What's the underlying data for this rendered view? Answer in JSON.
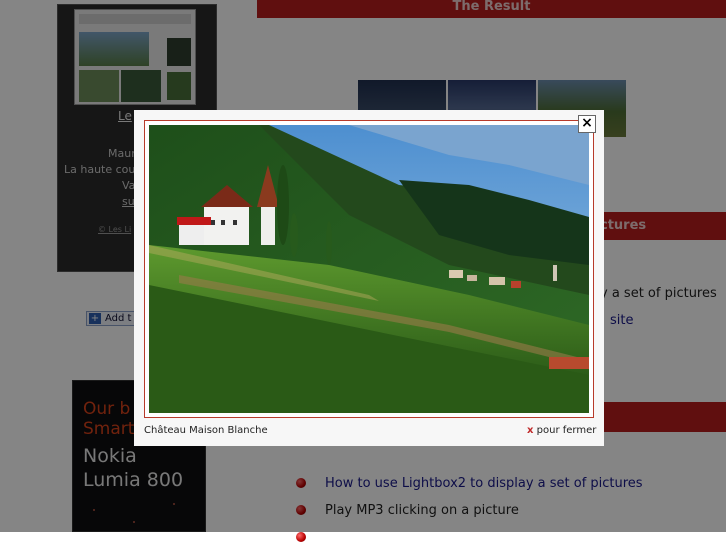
{
  "sidebar": {
    "site_link": "Le",
    "line1": "Maur",
    "line2": "La haute cout",
    "line3": "Va",
    "line4": "su",
    "footer_link": "© Les Li",
    "add_button": "Add t"
  },
  "ad": {
    "line1": "Our b",
    "line2": "Smart",
    "line3": "Nokia",
    "line4": "Lumia 800"
  },
  "main": {
    "result_title": "The Result",
    "section_title": "ctures",
    "text1": "y a set of pictures",
    "text2": "site",
    "list": [
      {
        "label": "How to use Lightbox2 to display a set of pictures",
        "link": true
      },
      {
        "label": "Play MP3 clicking on a picture",
        "link": false
      }
    ]
  },
  "lightbox": {
    "caption": "Château Maison Blanche",
    "close_x": "x",
    "close_label": "pour fermer",
    "close_button": "×"
  },
  "colors": {
    "accent_red": "#b91d1d",
    "link_blue": "#1a1a8a",
    "frame_red": "#b73a2a"
  }
}
